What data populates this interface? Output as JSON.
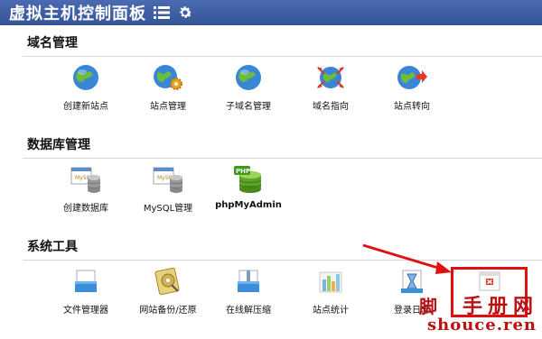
{
  "topbar": {
    "title": "虚拟主机控制面板",
    "icons": [
      "menu-icon",
      "gear-icon"
    ]
  },
  "sections": [
    {
      "title": "域名管理",
      "items": [
        {
          "label": "创建新站点",
          "icon": "globe-icon"
        },
        {
          "label": "站点管理",
          "icon": "globe-gear-icon"
        },
        {
          "label": "子域名管理",
          "icon": "globe-icon"
        },
        {
          "label": "域名指向",
          "icon": "globe-arrows-icon"
        },
        {
          "label": "站点转向",
          "icon": "globe-redirect-icon"
        }
      ]
    },
    {
      "title": "数据库管理",
      "items": [
        {
          "label": "创建数据库",
          "icon": "mysql-database-icon"
        },
        {
          "label": "MySQL管理",
          "icon": "mysql-database-icon"
        },
        {
          "label": "phpMyAdmin",
          "icon": "php-database-icon"
        }
      ]
    },
    {
      "title": "系统工具",
      "items": [
        {
          "label": "文件管理器",
          "icon": "file-manager-icon"
        },
        {
          "label": "网站备份/还原",
          "icon": "backup-disk-icon"
        },
        {
          "label": "在线解压缩",
          "icon": "unzip-icon"
        },
        {
          "label": "站点统计",
          "icon": "bar-chart-icon"
        },
        {
          "label": "登录日志",
          "icon": "hourglass-log-icon"
        },
        {
          "label": "",
          "icon": "error-window-icon"
        }
      ]
    }
  ],
  "watermark": {
    "line1": "手册网",
    "line2": "shouce.ren",
    "glyph": "脚"
  },
  "colors": {
    "topbar": "#3c5ca3",
    "annotation": "#e01010"
  }
}
